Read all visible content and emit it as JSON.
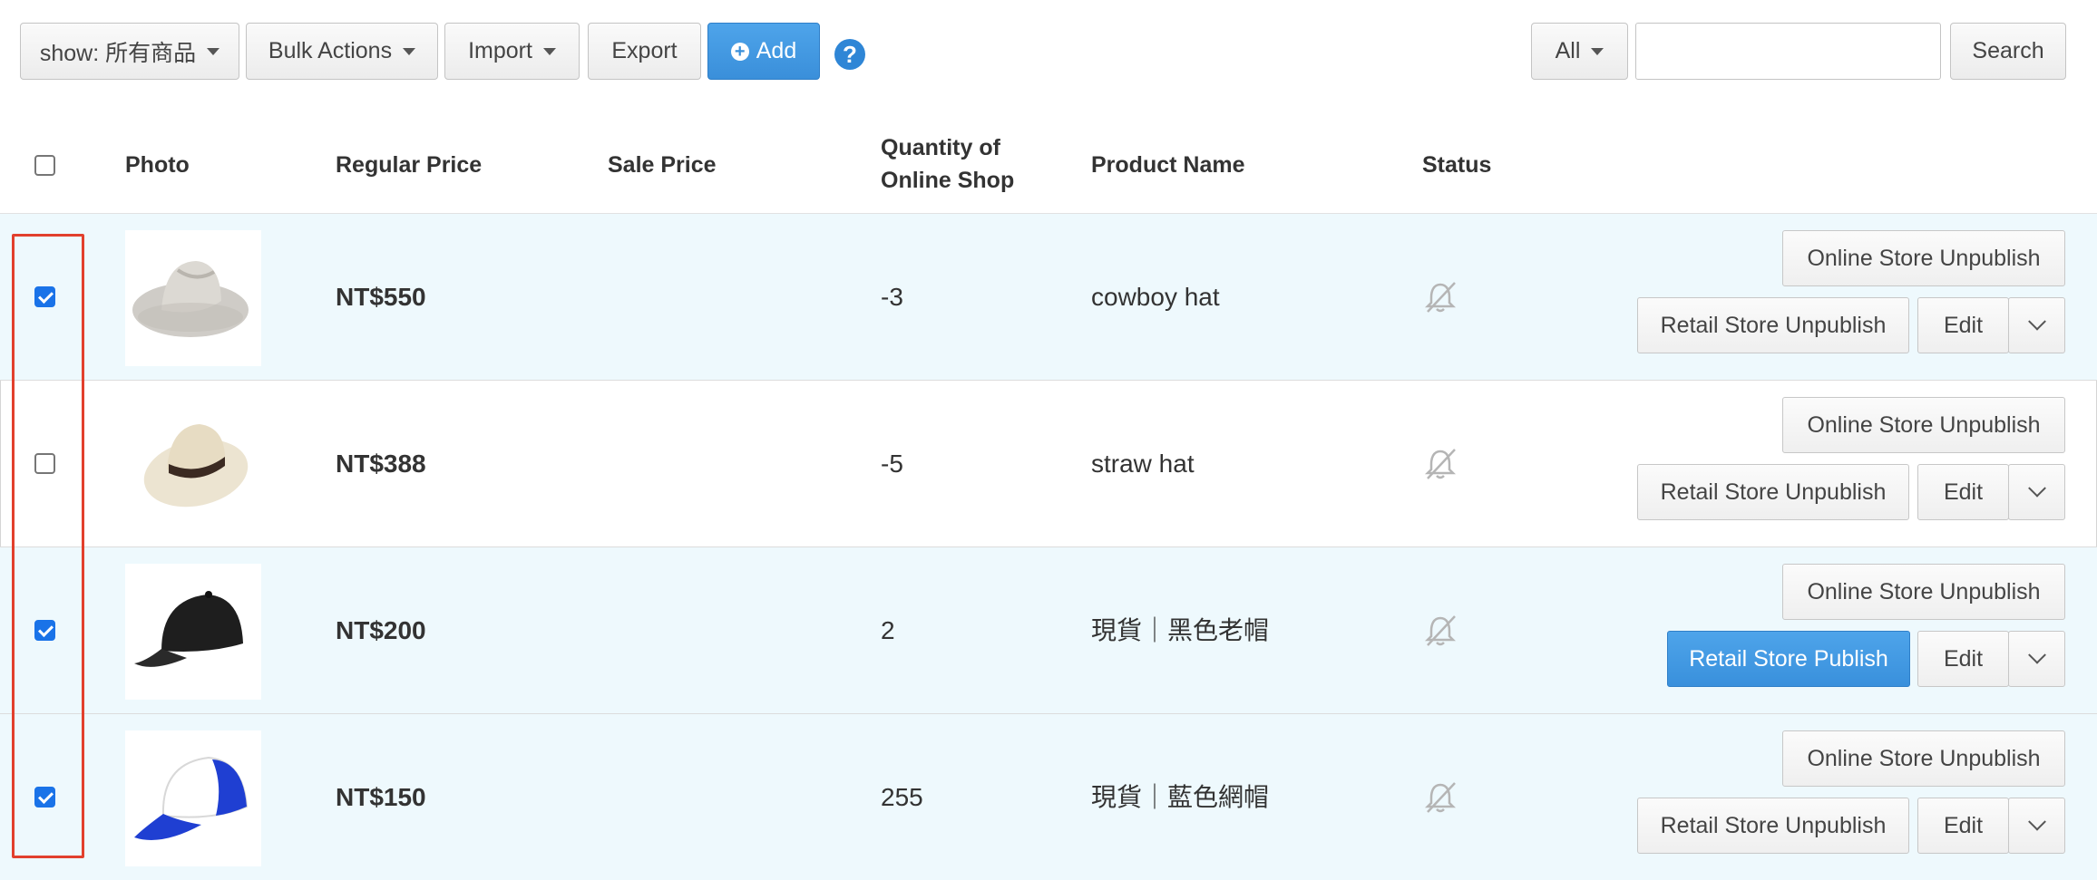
{
  "toolbar": {
    "show_label": "show: 所有商品",
    "bulk_label": "Bulk Actions",
    "import_label": "Import",
    "export_label": "Export",
    "add_label": "Add",
    "filter_label": "All",
    "search_value": "",
    "search_label": "Search"
  },
  "header": {
    "photo": "Photo",
    "regular_price": "Regular Price",
    "sale_price": "Sale Price",
    "qty_line1": "Quantity of",
    "qty_line2": "Online Shop",
    "product_name": "Product Name",
    "status": "Status"
  },
  "rows": [
    {
      "checked": true,
      "price": "NT$550",
      "sale": "",
      "qty": "-3",
      "name": "cowboy hat",
      "online_btn": "Online Store Unpublish",
      "retail_btn": "Retail Store Unpublish",
      "edit": "Edit",
      "image": "cowboy-hat-image"
    },
    {
      "checked": false,
      "price": "NT$388",
      "sale": "",
      "qty": "-5",
      "name": "straw hat",
      "online_btn": "Online Store Unpublish",
      "retail_btn": "Retail Store Unpublish",
      "edit": "Edit",
      "image": "straw-hat-image"
    },
    {
      "checked": true,
      "price": "NT$200",
      "sale": "",
      "qty": "2",
      "name": "現貨｜黑色老帽",
      "online_btn": "Online Store Unpublish",
      "retail_btn": "Retail Store Publish",
      "edit": "Edit",
      "image": "black-cap-image"
    },
    {
      "checked": true,
      "price": "NT$150",
      "sale": "",
      "qty": "255",
      "name": "現貨｜藍色網帽",
      "online_btn": "Online Store Unpublish",
      "retail_btn": "Retail Store Unpublish",
      "edit": "Edit",
      "image": "blue-trucker-cap-image"
    }
  ],
  "colors": {
    "primary": "#3a8fda",
    "highlight_row": "#eef9fd",
    "selection_outline": "#e2402d"
  }
}
